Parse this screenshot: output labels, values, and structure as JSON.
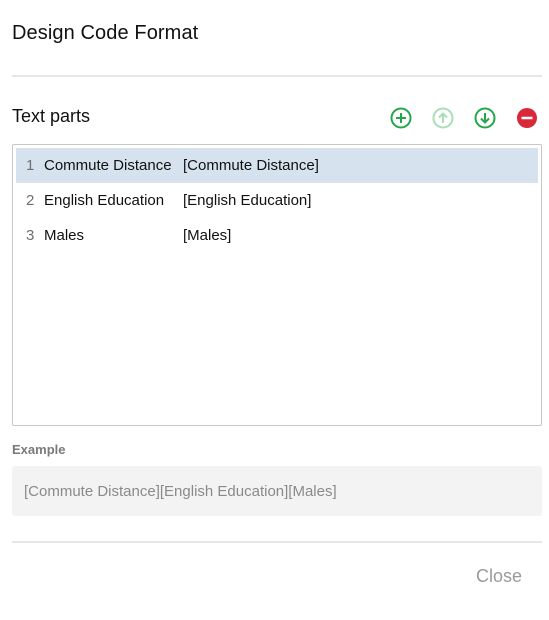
{
  "dialog": {
    "title": "Design Code Format",
    "close_label": "Close"
  },
  "text_parts": {
    "label": "Text parts",
    "toolbar": [
      {
        "icon": "add-circle-icon",
        "color": "#22a84a",
        "enabled": true
      },
      {
        "icon": "arrow-up-circle-icon",
        "color": "#a8dfb6",
        "enabled": false
      },
      {
        "icon": "arrow-down-circle-icon",
        "color": "#22a84a",
        "enabled": true
      },
      {
        "icon": "remove-circle-icon",
        "color": "#d9283a",
        "enabled": true
      }
    ],
    "rows": [
      {
        "num": "1",
        "name": "Commute Distance",
        "code": "[Commute Distance]",
        "selected": true
      },
      {
        "num": "2",
        "name": "English Education",
        "code": "[English Education]",
        "selected": false
      },
      {
        "num": "3",
        "name": "Males",
        "code": "[Males]",
        "selected": false
      }
    ]
  },
  "example": {
    "label": "Example",
    "value": "[Commute Distance][English Education][Males]"
  },
  "colors": {
    "selected_row": "#d6e3ee",
    "accent_green": "#22a84a",
    "accent_red": "#d9283a"
  }
}
